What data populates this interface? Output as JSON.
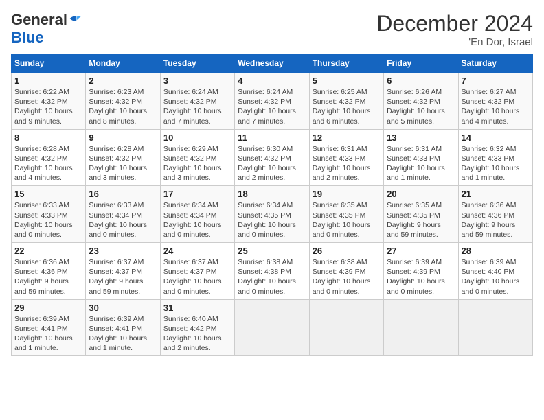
{
  "header": {
    "logo_general": "General",
    "logo_blue": "Blue",
    "month": "December 2024",
    "location": "'En Dor, Israel"
  },
  "weekdays": [
    "Sunday",
    "Monday",
    "Tuesday",
    "Wednesday",
    "Thursday",
    "Friday",
    "Saturday"
  ],
  "weeks": [
    [
      {
        "day": 1,
        "detail": "Sunrise: 6:22 AM\nSunset: 4:32 PM\nDaylight: 10 hours\nand 9 minutes."
      },
      {
        "day": 2,
        "detail": "Sunrise: 6:23 AM\nSunset: 4:32 PM\nDaylight: 10 hours\nand 8 minutes."
      },
      {
        "day": 3,
        "detail": "Sunrise: 6:24 AM\nSunset: 4:32 PM\nDaylight: 10 hours\nand 7 minutes."
      },
      {
        "day": 4,
        "detail": "Sunrise: 6:24 AM\nSunset: 4:32 PM\nDaylight: 10 hours\nand 7 minutes."
      },
      {
        "day": 5,
        "detail": "Sunrise: 6:25 AM\nSunset: 4:32 PM\nDaylight: 10 hours\nand 6 minutes."
      },
      {
        "day": 6,
        "detail": "Sunrise: 6:26 AM\nSunset: 4:32 PM\nDaylight: 10 hours\nand 5 minutes."
      },
      {
        "day": 7,
        "detail": "Sunrise: 6:27 AM\nSunset: 4:32 PM\nDaylight: 10 hours\nand 4 minutes."
      }
    ],
    [
      {
        "day": 8,
        "detail": "Sunrise: 6:28 AM\nSunset: 4:32 PM\nDaylight: 10 hours\nand 4 minutes."
      },
      {
        "day": 9,
        "detail": "Sunrise: 6:28 AM\nSunset: 4:32 PM\nDaylight: 10 hours\nand 3 minutes."
      },
      {
        "day": 10,
        "detail": "Sunrise: 6:29 AM\nSunset: 4:32 PM\nDaylight: 10 hours\nand 3 minutes."
      },
      {
        "day": 11,
        "detail": "Sunrise: 6:30 AM\nSunset: 4:32 PM\nDaylight: 10 hours\nand 2 minutes."
      },
      {
        "day": 12,
        "detail": "Sunrise: 6:31 AM\nSunset: 4:33 PM\nDaylight: 10 hours\nand 2 minutes."
      },
      {
        "day": 13,
        "detail": "Sunrise: 6:31 AM\nSunset: 4:33 PM\nDaylight: 10 hours\nand 1 minute."
      },
      {
        "day": 14,
        "detail": "Sunrise: 6:32 AM\nSunset: 4:33 PM\nDaylight: 10 hours\nand 1 minute."
      }
    ],
    [
      {
        "day": 15,
        "detail": "Sunrise: 6:33 AM\nSunset: 4:33 PM\nDaylight: 10 hours\nand 0 minutes."
      },
      {
        "day": 16,
        "detail": "Sunrise: 6:33 AM\nSunset: 4:34 PM\nDaylight: 10 hours\nand 0 minutes."
      },
      {
        "day": 17,
        "detail": "Sunrise: 6:34 AM\nSunset: 4:34 PM\nDaylight: 10 hours\nand 0 minutes."
      },
      {
        "day": 18,
        "detail": "Sunrise: 6:34 AM\nSunset: 4:35 PM\nDaylight: 10 hours\nand 0 minutes."
      },
      {
        "day": 19,
        "detail": "Sunrise: 6:35 AM\nSunset: 4:35 PM\nDaylight: 10 hours\nand 0 minutes."
      },
      {
        "day": 20,
        "detail": "Sunrise: 6:35 AM\nSunset: 4:35 PM\nDaylight: 9 hours\nand 59 minutes."
      },
      {
        "day": 21,
        "detail": "Sunrise: 6:36 AM\nSunset: 4:36 PM\nDaylight: 9 hours\nand 59 minutes."
      }
    ],
    [
      {
        "day": 22,
        "detail": "Sunrise: 6:36 AM\nSunset: 4:36 PM\nDaylight: 9 hours\nand 59 minutes."
      },
      {
        "day": 23,
        "detail": "Sunrise: 6:37 AM\nSunset: 4:37 PM\nDaylight: 9 hours\nand 59 minutes."
      },
      {
        "day": 24,
        "detail": "Sunrise: 6:37 AM\nSunset: 4:37 PM\nDaylight: 10 hours\nand 0 minutes."
      },
      {
        "day": 25,
        "detail": "Sunrise: 6:38 AM\nSunset: 4:38 PM\nDaylight: 10 hours\nand 0 minutes."
      },
      {
        "day": 26,
        "detail": "Sunrise: 6:38 AM\nSunset: 4:39 PM\nDaylight: 10 hours\nand 0 minutes."
      },
      {
        "day": 27,
        "detail": "Sunrise: 6:39 AM\nSunset: 4:39 PM\nDaylight: 10 hours\nand 0 minutes."
      },
      {
        "day": 28,
        "detail": "Sunrise: 6:39 AM\nSunset: 4:40 PM\nDaylight: 10 hours\nand 0 minutes."
      }
    ],
    [
      {
        "day": 29,
        "detail": "Sunrise: 6:39 AM\nSunset: 4:41 PM\nDaylight: 10 hours\nand 1 minute."
      },
      {
        "day": 30,
        "detail": "Sunrise: 6:39 AM\nSunset: 4:41 PM\nDaylight: 10 hours\nand 1 minute."
      },
      {
        "day": 31,
        "detail": "Sunrise: 6:40 AM\nSunset: 4:42 PM\nDaylight: 10 hours\nand 2 minutes."
      },
      null,
      null,
      null,
      null
    ]
  ]
}
